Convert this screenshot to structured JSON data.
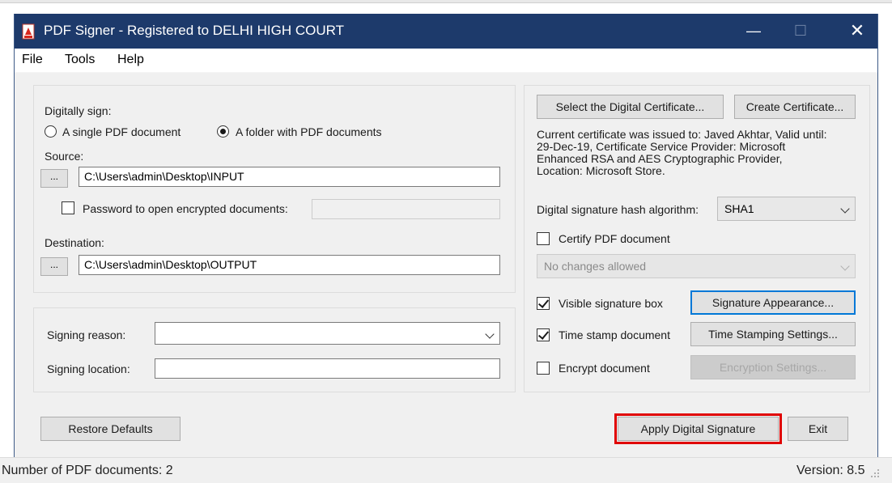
{
  "window": {
    "title": "PDF Signer - Registered to DELHI HIGH COURT",
    "minimize_glyph": "—",
    "maximize_glyph": "☐",
    "close_glyph": "✕",
    "title_bg": "#1d3a6b"
  },
  "menu": {
    "items": [
      "File",
      "Tools",
      "Help"
    ]
  },
  "sign": {
    "group_label": "Digitally sign:",
    "option_single": "A single PDF document",
    "option_folder": "A folder with PDF documents",
    "selected": "folder",
    "source_label": "Source:",
    "source_browse": "...",
    "source_value": "C:\\Users\\admin\\Desktop\\INPUT",
    "password_label": "Password to open encrypted documents:",
    "password_checked": false,
    "password_value": "",
    "destination_label": "Destination:",
    "destination_browse": "...",
    "destination_value": "C:\\Users\\admin\\Desktop\\OUTPUT"
  },
  "reason": {
    "reason_label": "Signing reason:",
    "reason_value": "",
    "location_label": "Signing location:",
    "location_value": ""
  },
  "certificate": {
    "select_button": "Select the Digital Certificate...",
    "create_button": "Create Certificate...",
    "info_lines": [
      "Current certificate was issued to: Javed Akhtar, Valid until:",
      "29-Dec-19, Certificate Service Provider: Microsoft",
      "Enhanced RSA and AES Cryptographic Provider,",
      "Location: Microsoft Store."
    ],
    "hash_label": "Digital signature hash algorithm:",
    "hash_value": "SHA1",
    "certify_label": "Certify PDF document",
    "certify_checked": false,
    "changes_value": "No changes allowed",
    "visible_label": "Visible signature box",
    "visible_checked": true,
    "appearance_button": "Signature Appearance...",
    "timestamp_label": "Time stamp document",
    "timestamp_checked": true,
    "timestamp_button": "Time Stamping Settings...",
    "encrypt_label": "Encrypt document",
    "encrypt_checked": false,
    "encrypt_button": "Encryption Settings..."
  },
  "actions": {
    "restore_button": "Restore Defaults",
    "apply_button": "Apply Digital Signature",
    "exit_button": "Exit",
    "highlight_color": "#e00000"
  },
  "status": {
    "count_text": "Number of PDF documents: 2",
    "version_text": "Version: 8.5"
  }
}
